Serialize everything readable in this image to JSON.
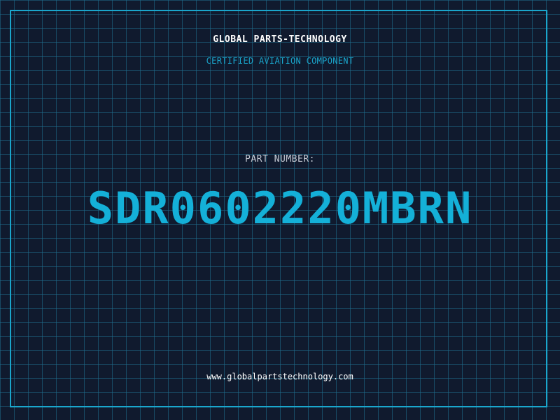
{
  "header": {
    "company": "GLOBAL PARTS-TECHNOLOGY",
    "tagline": "CERTIFIED AVIATION COMPONENT"
  },
  "part": {
    "label": "PART NUMBER:",
    "number": "SDR0602220MBRN"
  },
  "footer": {
    "website": "www.globalpartstechnology.com"
  },
  "colors": {
    "background": "#101a2e",
    "grid": "#206e8c",
    "accent": "#14b0d8",
    "frame": "#1aa6cc"
  }
}
